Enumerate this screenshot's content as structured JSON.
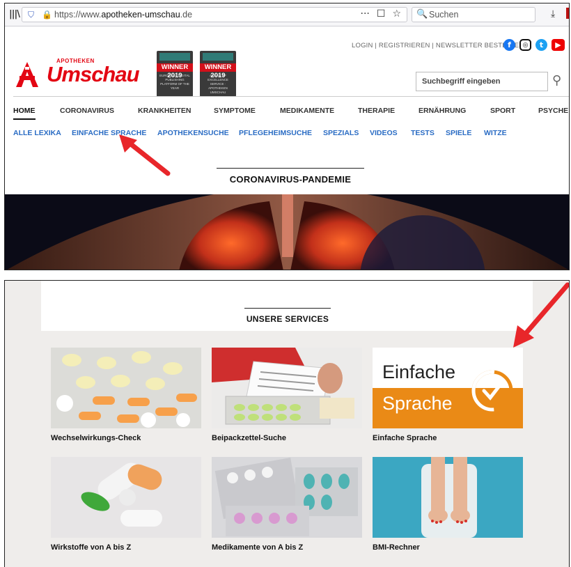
{
  "browser": {
    "url_prefix": "https://www.",
    "url_domain": "apotheken-umschau",
    "url_suffix": ".de",
    "url_more": "···",
    "search_placeholder": "Suchen"
  },
  "header": {
    "top_links": "LOGIN | REGISTRIEREN | NEWSLETTER BESTELLEN",
    "logo_small": "APOTHEKEN",
    "logo_word": "Umschau",
    "awards": [
      {
        "winner": "WINNER 2019",
        "text": "EUROPEAN DIGITAL PUBLISHING PLATFORM OF THE YEAR"
      },
      {
        "winner": "WINNER 2019",
        "text": "AWARD OF EXCELLENCE SERVICE · APOTHEKEN UMSCHAU"
      }
    ],
    "search_placeholder": "Suchbegriff eingeben",
    "social": {
      "facebook": "f",
      "instagram": "◎",
      "twitter": "t",
      "youtube": "▶"
    }
  },
  "nav": {
    "main": [
      "HOME",
      "CORONAVIRUS",
      "KRANKHEITEN",
      "SYMPTOME",
      "MEDIKAMENTE",
      "THERAPIE",
      "ERNÄHRUNG",
      "SPORT",
      "PSYCHE"
    ],
    "sub": [
      "ALLE LEXIKA",
      "EINFACHE SPRACHE",
      "APOTHEKENSUCHE",
      "PFLEGEHEIMSUCHE",
      "SPEZIALS",
      "VIDEOS",
      "TESTS",
      "SPIELE",
      "WITZE"
    ]
  },
  "hero": {
    "section_title": "CORONAVIRUS-PANDEMIE"
  },
  "services": {
    "section_title": "UNSERE SERVICES",
    "cards": [
      {
        "label": "Wechselwirkungs-Check"
      },
      {
        "label": "Beipackzettel-Suche"
      },
      {
        "label": "Einfache Sprache",
        "img_line1": "Einfache",
        "img_line2": "Sprache"
      },
      {
        "label": "Wirkstoffe von A bis Z"
      },
      {
        "label": "Medikamente von A bis Z"
      },
      {
        "label": "BMI-Rechner"
      }
    ]
  },
  "colors": {
    "brand_red": "#e30613",
    "link_blue": "#2a6cc4",
    "annotation_arrow": "#e8262a",
    "einfache_orange": "#ea8a16"
  }
}
